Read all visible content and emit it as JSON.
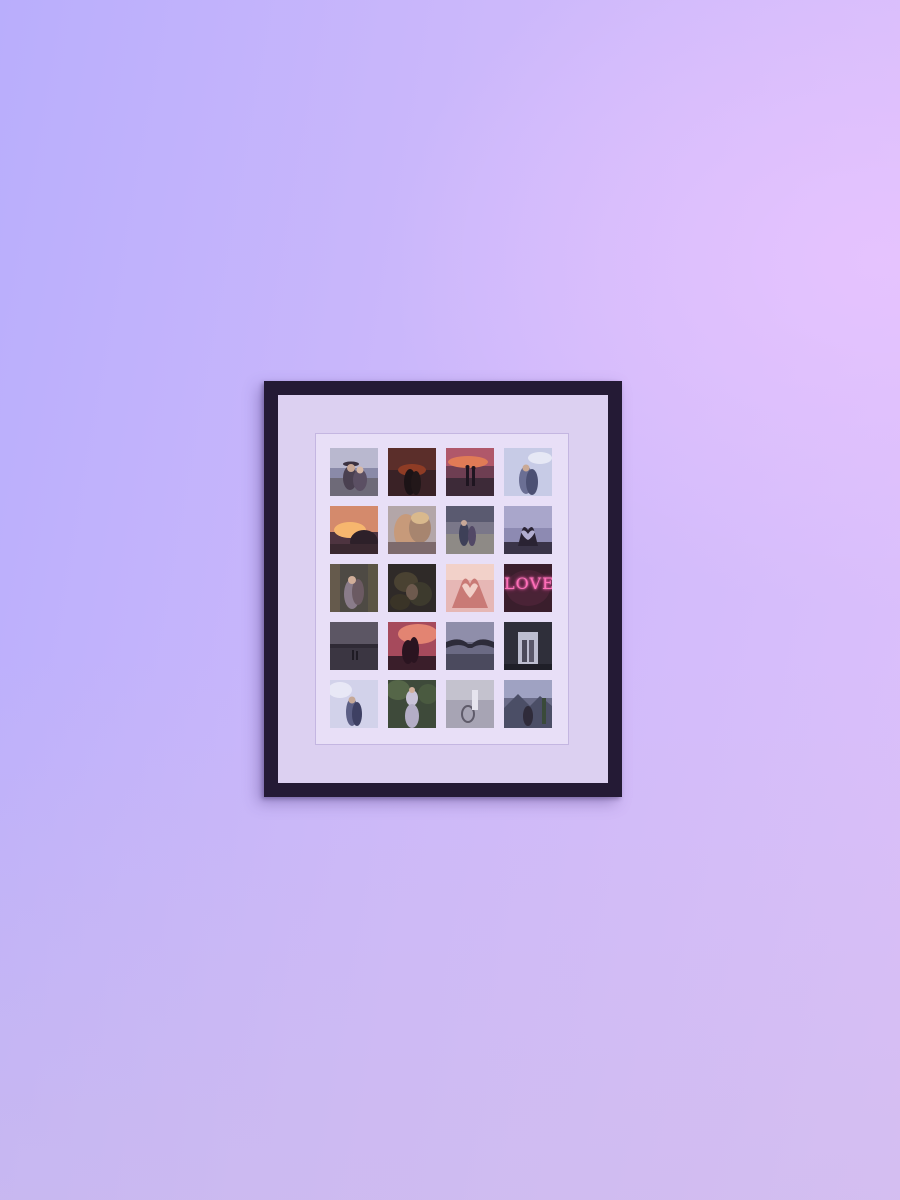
{
  "scene": {
    "wall_colors": [
      "#b9aefc",
      "#dcc0fb"
    ],
    "frame_color": "#241a35",
    "mat_color": "#dcd0f1"
  },
  "photos": [
    {
      "subject": "couple-in-hats"
    },
    {
      "subject": "couple-dark-silhouette"
    },
    {
      "subject": "couple-sunset-beach"
    },
    {
      "subject": "couple-sky"
    },
    {
      "subject": "sunset-glow"
    },
    {
      "subject": "couple-closeup"
    },
    {
      "subject": "couple-field"
    },
    {
      "subject": "hand-heart-sky"
    },
    {
      "subject": "couple-in-forest"
    },
    {
      "subject": "dark-foliage"
    },
    {
      "subject": "hand-heart-pink"
    },
    {
      "subject": "neon-love-sign",
      "text": "LOVE"
    },
    {
      "subject": "couple-lake"
    },
    {
      "subject": "couple-red-sunset"
    },
    {
      "subject": "holding-hands"
    },
    {
      "subject": "couple-doorway"
    },
    {
      "subject": "couple-embrace-sky"
    },
    {
      "subject": "couple-lifting"
    },
    {
      "subject": "wedding-shoes"
    },
    {
      "subject": "couple-mountain"
    }
  ]
}
